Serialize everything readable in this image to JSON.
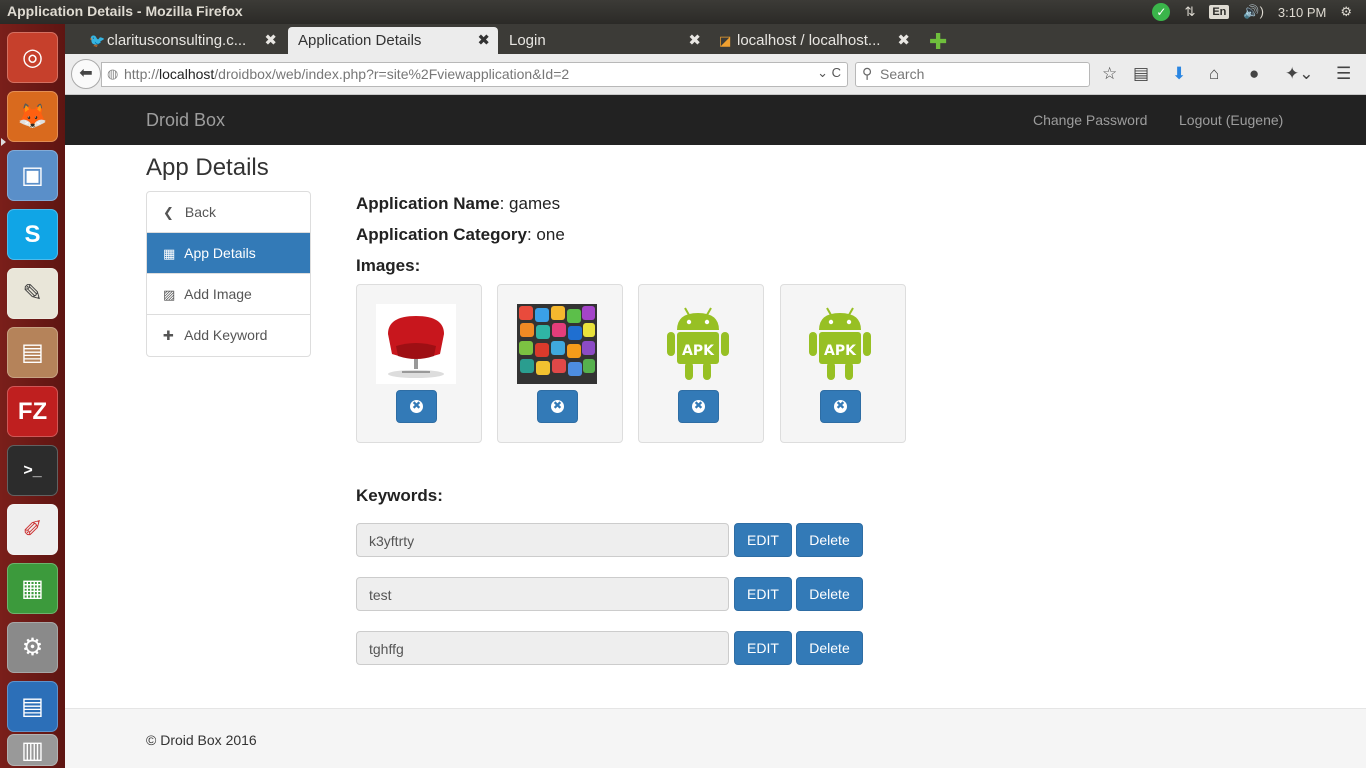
{
  "top_panel": {
    "window_title": "Application Details - Mozilla Firefox",
    "lang": "En",
    "volume": "🔊)",
    "network": "⇅",
    "clock": "3:10 PM",
    "check": "✓",
    "gear": "⚙"
  },
  "launcher": {
    "ubuntu": "◎",
    "firefox": "🦊",
    "box": "▣",
    "skype": "S",
    "editor": "✎",
    "files": "▤",
    "filezilla": "FZ",
    "terminal": ">_",
    "pdf": "✐",
    "calc": "▦",
    "settings": "⚙",
    "writer": "▤",
    "trash": "▥"
  },
  "tabs": [
    {
      "label": "claritusconsulting.c...",
      "favicon": "🐦",
      "close": "✖"
    },
    {
      "label": "Application Details",
      "favicon": "",
      "close": "✖"
    },
    {
      "label": "Login",
      "favicon": "",
      "close": "✖"
    },
    {
      "label": "localhost / localhost...",
      "favicon": "◪",
      "close": "✖"
    }
  ],
  "new_tab": "✚",
  "navbar": {
    "back": "⬅",
    "url_prefix": "http://",
    "url_host": "localhost",
    "url_path": "/droidbox/web/index.php?r=site%2Fviewapplication&Id=2",
    "url_tools": "⌄ C",
    "search_placeholder": "Search",
    "search_icon": "⚲",
    "bookmark": "☆",
    "reader": "▤",
    "download": "⬇",
    "home": "⌂",
    "chat": "●",
    "ext": "✦⌄",
    "menu": "☰"
  },
  "site": {
    "brand": "Droid Box",
    "change_password": "Change Password",
    "logout": "Logout (Eugene)"
  },
  "page_title": "App Details",
  "side_menu": [
    {
      "icon": "❮",
      "label": "Back",
      "active": false
    },
    {
      "icon": "▦",
      "label": "App Details",
      "active": true
    },
    {
      "icon": "▨",
      "label": "Add Image",
      "active": false
    },
    {
      "icon": "✚",
      "label": "Add Keyword",
      "active": false
    }
  ],
  "details": {
    "name_label": "Application Name",
    "name_value": ": games",
    "category_label": "Application Category",
    "category_value": ": one",
    "images_label": "Images:",
    "keywords_label": "Keywords:"
  },
  "images": [
    {
      "type": "red-chair"
    },
    {
      "type": "app-icons-collage"
    },
    {
      "type": "android-apk",
      "text": "APK"
    },
    {
      "type": "android-apk",
      "text": "APK"
    }
  ],
  "image_delete_glyph": "✖",
  "keywords": [
    {
      "value": "k3yftrty",
      "edit": "EDIT",
      "delete": "Delete"
    },
    {
      "value": "test",
      "edit": "EDIT",
      "delete": "Delete"
    },
    {
      "value": "tghffg",
      "edit": "EDIT",
      "delete": "Delete"
    }
  ],
  "footer": "© Droid Box 2016",
  "colors": {
    "primary": "#337ab7",
    "navbar_bg": "#222222",
    "android_green": "#97c024",
    "launcher_bg": "#6b1a16"
  }
}
